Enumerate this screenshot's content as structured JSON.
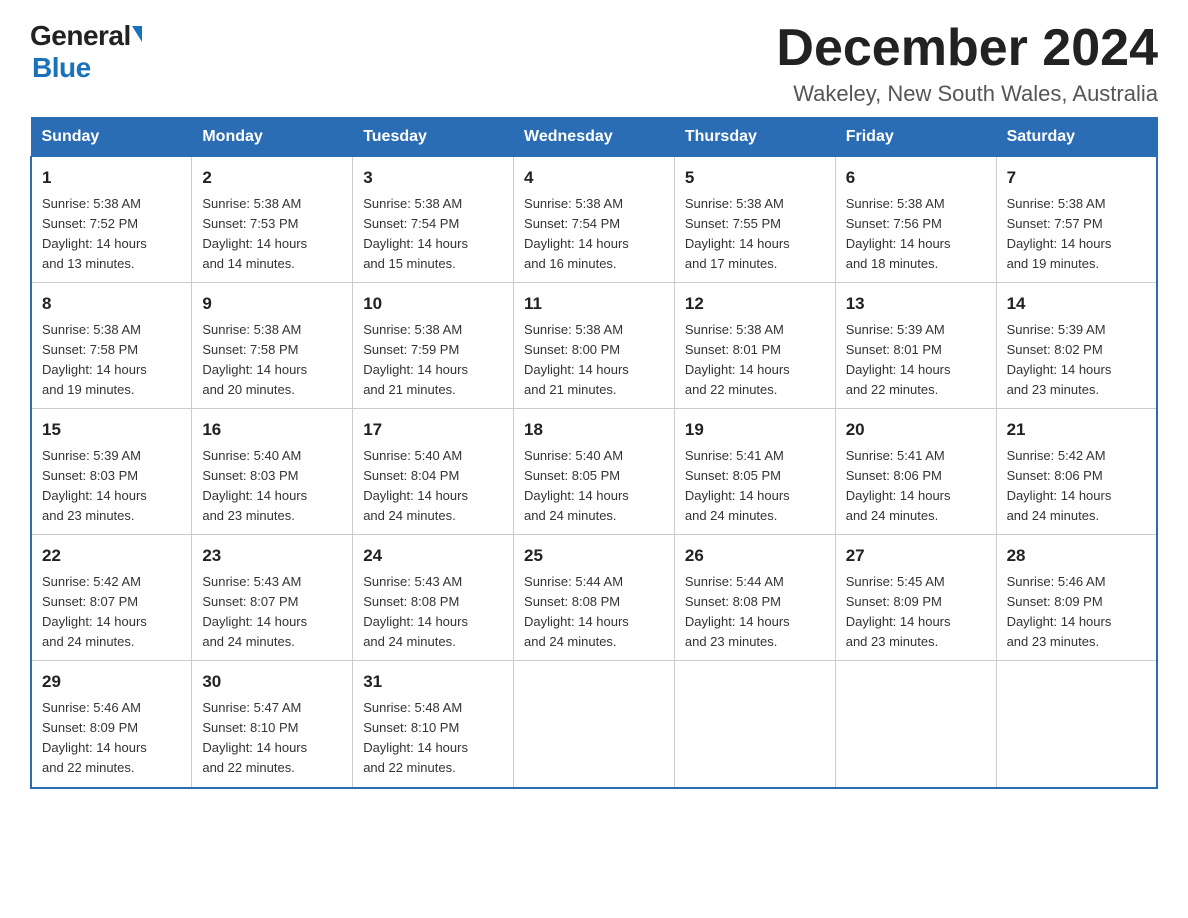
{
  "logo": {
    "general": "General",
    "blue": "Blue"
  },
  "title": "December 2024",
  "location": "Wakeley, New South Wales, Australia",
  "days_of_week": [
    "Sunday",
    "Monday",
    "Tuesday",
    "Wednesday",
    "Thursday",
    "Friday",
    "Saturday"
  ],
  "weeks": [
    [
      {
        "day": "1",
        "sunrise": "5:38 AM",
        "sunset": "7:52 PM",
        "daylight": "14 hours and 13 minutes."
      },
      {
        "day": "2",
        "sunrise": "5:38 AM",
        "sunset": "7:53 PM",
        "daylight": "14 hours and 14 minutes."
      },
      {
        "day": "3",
        "sunrise": "5:38 AM",
        "sunset": "7:54 PM",
        "daylight": "14 hours and 15 minutes."
      },
      {
        "day": "4",
        "sunrise": "5:38 AM",
        "sunset": "7:54 PM",
        "daylight": "14 hours and 16 minutes."
      },
      {
        "day": "5",
        "sunrise": "5:38 AM",
        "sunset": "7:55 PM",
        "daylight": "14 hours and 17 minutes."
      },
      {
        "day": "6",
        "sunrise": "5:38 AM",
        "sunset": "7:56 PM",
        "daylight": "14 hours and 18 minutes."
      },
      {
        "day": "7",
        "sunrise": "5:38 AM",
        "sunset": "7:57 PM",
        "daylight": "14 hours and 19 minutes."
      }
    ],
    [
      {
        "day": "8",
        "sunrise": "5:38 AM",
        "sunset": "7:58 PM",
        "daylight": "14 hours and 19 minutes."
      },
      {
        "day": "9",
        "sunrise": "5:38 AM",
        "sunset": "7:58 PM",
        "daylight": "14 hours and 20 minutes."
      },
      {
        "day": "10",
        "sunrise": "5:38 AM",
        "sunset": "7:59 PM",
        "daylight": "14 hours and 21 minutes."
      },
      {
        "day": "11",
        "sunrise": "5:38 AM",
        "sunset": "8:00 PM",
        "daylight": "14 hours and 21 minutes."
      },
      {
        "day": "12",
        "sunrise": "5:38 AM",
        "sunset": "8:01 PM",
        "daylight": "14 hours and 22 minutes."
      },
      {
        "day": "13",
        "sunrise": "5:39 AM",
        "sunset": "8:01 PM",
        "daylight": "14 hours and 22 minutes."
      },
      {
        "day": "14",
        "sunrise": "5:39 AM",
        "sunset": "8:02 PM",
        "daylight": "14 hours and 23 minutes."
      }
    ],
    [
      {
        "day": "15",
        "sunrise": "5:39 AM",
        "sunset": "8:03 PM",
        "daylight": "14 hours and 23 minutes."
      },
      {
        "day": "16",
        "sunrise": "5:40 AM",
        "sunset": "8:03 PM",
        "daylight": "14 hours and 23 minutes."
      },
      {
        "day": "17",
        "sunrise": "5:40 AM",
        "sunset": "8:04 PM",
        "daylight": "14 hours and 24 minutes."
      },
      {
        "day": "18",
        "sunrise": "5:40 AM",
        "sunset": "8:05 PM",
        "daylight": "14 hours and 24 minutes."
      },
      {
        "day": "19",
        "sunrise": "5:41 AM",
        "sunset": "8:05 PM",
        "daylight": "14 hours and 24 minutes."
      },
      {
        "day": "20",
        "sunrise": "5:41 AM",
        "sunset": "8:06 PM",
        "daylight": "14 hours and 24 minutes."
      },
      {
        "day": "21",
        "sunrise": "5:42 AM",
        "sunset": "8:06 PM",
        "daylight": "14 hours and 24 minutes."
      }
    ],
    [
      {
        "day": "22",
        "sunrise": "5:42 AM",
        "sunset": "8:07 PM",
        "daylight": "14 hours and 24 minutes."
      },
      {
        "day": "23",
        "sunrise": "5:43 AM",
        "sunset": "8:07 PM",
        "daylight": "14 hours and 24 minutes."
      },
      {
        "day": "24",
        "sunrise": "5:43 AM",
        "sunset": "8:08 PM",
        "daylight": "14 hours and 24 minutes."
      },
      {
        "day": "25",
        "sunrise": "5:44 AM",
        "sunset": "8:08 PM",
        "daylight": "14 hours and 24 minutes."
      },
      {
        "day": "26",
        "sunrise": "5:44 AM",
        "sunset": "8:08 PM",
        "daylight": "14 hours and 23 minutes."
      },
      {
        "day": "27",
        "sunrise": "5:45 AM",
        "sunset": "8:09 PM",
        "daylight": "14 hours and 23 minutes."
      },
      {
        "day": "28",
        "sunrise": "5:46 AM",
        "sunset": "8:09 PM",
        "daylight": "14 hours and 23 minutes."
      }
    ],
    [
      {
        "day": "29",
        "sunrise": "5:46 AM",
        "sunset": "8:09 PM",
        "daylight": "14 hours and 22 minutes."
      },
      {
        "day": "30",
        "sunrise": "5:47 AM",
        "sunset": "8:10 PM",
        "daylight": "14 hours and 22 minutes."
      },
      {
        "day": "31",
        "sunrise": "5:48 AM",
        "sunset": "8:10 PM",
        "daylight": "14 hours and 22 minutes."
      },
      null,
      null,
      null,
      null
    ]
  ],
  "labels": {
    "sunrise": "Sunrise:",
    "sunset": "Sunset:",
    "daylight": "Daylight:"
  }
}
